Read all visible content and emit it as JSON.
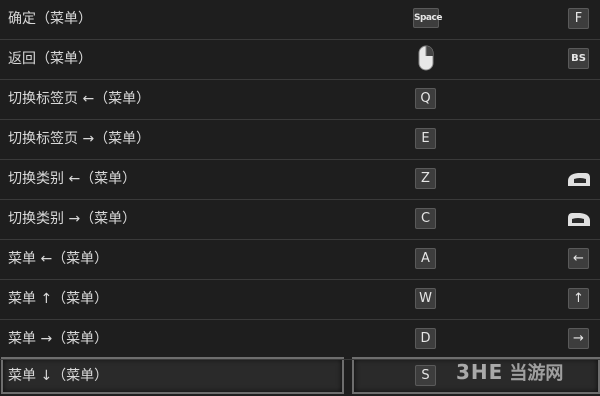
{
  "rows": [
    {
      "label": "确定（菜单）",
      "key": "Space",
      "alt": "F"
    },
    {
      "label": "返回（菜单）",
      "key_icon": "mouse-right-icon",
      "alt": "BS"
    },
    {
      "label": "切换标签页 ←（菜单）",
      "key": "Q",
      "alt": ""
    },
    {
      "label": "切换标签页 →（菜单）",
      "key": "E",
      "alt": ""
    },
    {
      "label": "切换类别 ←（菜单）",
      "key": "Z",
      "alt_icon": "gamepad-trigger-left-icon"
    },
    {
      "label": "切换类别 →（菜单）",
      "key": "C",
      "alt_icon": "gamepad-trigger-right-icon"
    },
    {
      "label": "菜单 ←（菜单）",
      "key": "A",
      "alt": "←"
    },
    {
      "label": "菜单 ↑（菜单）",
      "key": "W",
      "alt": "↑"
    },
    {
      "label": "菜单 →（菜单）",
      "key": "D",
      "alt": "→"
    },
    {
      "label": "菜单 ↓（菜单）",
      "key": "S",
      "alt": ""
    }
  ],
  "watermark": {
    "logo": "3HE",
    "text": "当游网"
  },
  "colors": {
    "background": "#1e1e1e",
    "key_bg": "#3d3d3d",
    "divider": "#3a3a3a"
  }
}
